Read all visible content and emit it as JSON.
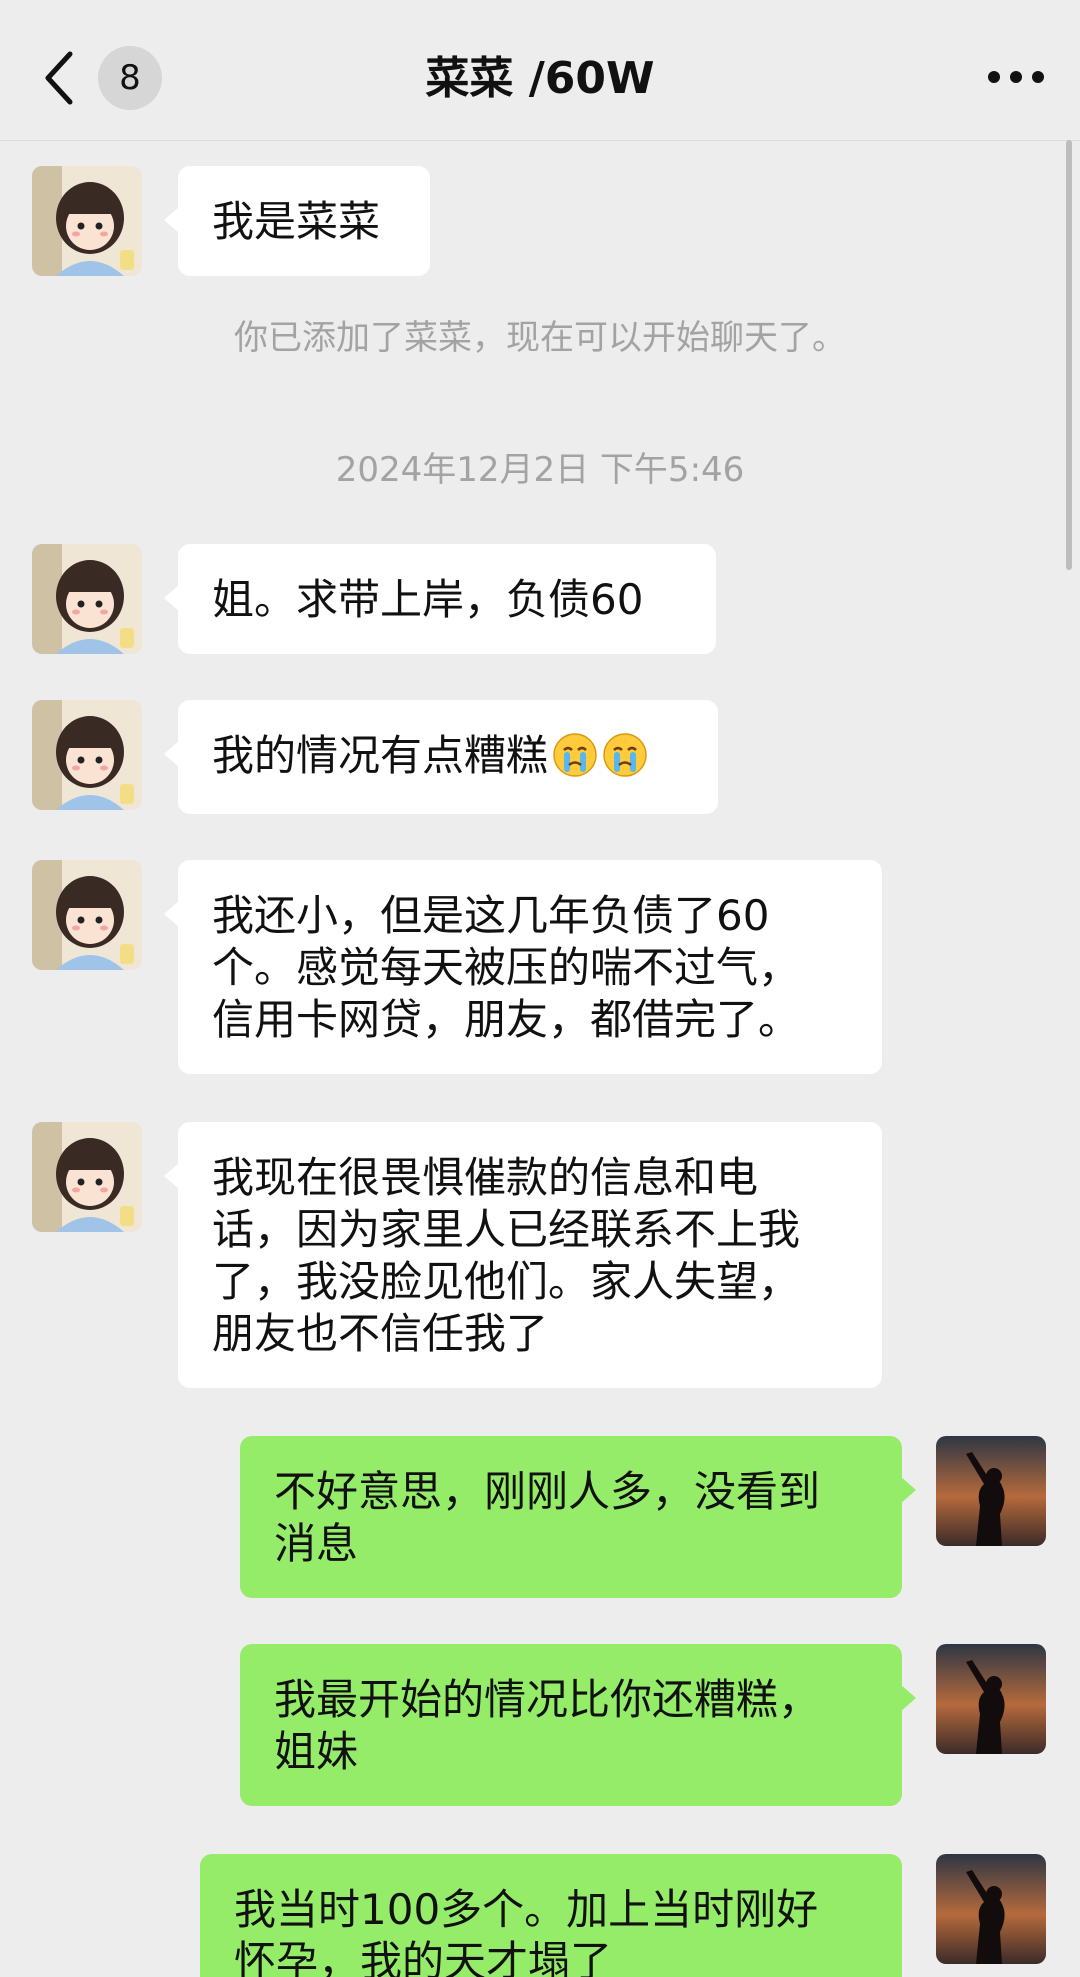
{
  "header": {
    "title": "菜菜 /60W",
    "unread_count": "8"
  },
  "system": {
    "added_notice": "你已添加了菜菜，现在可以开始聊天了。",
    "timestamp": "2024年12月2日 下午5:46"
  },
  "messages": [
    {
      "side": "in",
      "text": "我是菜菜"
    },
    {
      "side": "in",
      "text": "姐。求带上岸，负债60"
    },
    {
      "side": "in",
      "text": "我的情况有点糟糕",
      "emoji": [
        "crying-face-icon",
        "crying-face-icon"
      ]
    },
    {
      "side": "in",
      "lines": [
        "我还小，但是这几年负债了60",
        "个。感觉每天被压的喘不过气，",
        "信用卡网贷，朋友，都借完了。"
      ]
    },
    {
      "side": "in",
      "lines": [
        "我现在很畏惧催款的信息和电",
        "话，因为家里人已经联系不上我",
        "了，我没脸见他们。家人失望，",
        "朋友也不信任我了"
      ]
    },
    {
      "side": "out",
      "lines": [
        "不好意思，刚刚人多，没看到",
        "消息"
      ]
    },
    {
      "side": "out",
      "lines": [
        "我最开始的情况比你还糟糕，",
        "姐妹"
      ]
    },
    {
      "side": "out",
      "lines": [
        "我当时100多个。加上当时刚好",
        "怀孕，我的天才塌了"
      ]
    }
  ],
  "colors": {
    "background": "#ededed",
    "incoming_bubble": "#ffffff",
    "outgoing_bubble": "#95ec69"
  }
}
